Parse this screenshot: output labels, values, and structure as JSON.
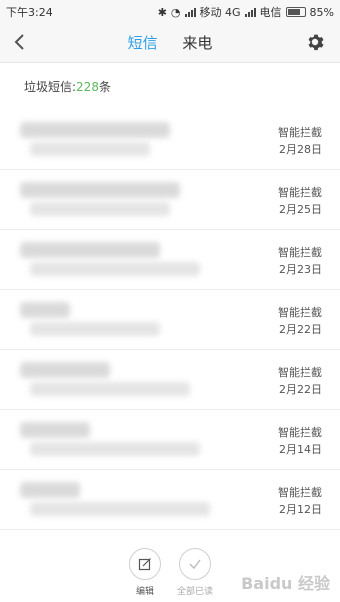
{
  "status_bar": {
    "time": "下午3:24",
    "carrier1": "移动 4G",
    "carrier2": "电信",
    "battery": "85%",
    "battery_level": 0.85
  },
  "header": {
    "back_icon": "chevron-left-icon",
    "tabs": [
      {
        "label": "短信",
        "active": true
      },
      {
        "label": "来电",
        "active": false
      }
    ],
    "settings_icon": "gear-icon"
  },
  "spam_info": {
    "prefix": "垃圾短信:",
    "count": "228",
    "suffix": "条"
  },
  "messages": [
    {
      "tag": "智能拦截",
      "date": "2月28日"
    },
    {
      "tag": "智能拦截",
      "date": "2月25日"
    },
    {
      "tag": "智能拦截",
      "date": "2月23日"
    },
    {
      "tag": "智能拦截",
      "date": "2月22日"
    },
    {
      "tag": "智能拦截",
      "date": "2月22日"
    },
    {
      "tag": "智能拦截",
      "date": "2月14日"
    },
    {
      "tag": "智能拦截",
      "date": "2月12日"
    }
  ],
  "bottom_bar": {
    "edit_label": "编辑",
    "mark_all_read_label": "全部已读"
  },
  "watermark": "Baidu 经验",
  "colors": {
    "accent": "#2e9fe6",
    "count": "#5cb85c"
  }
}
